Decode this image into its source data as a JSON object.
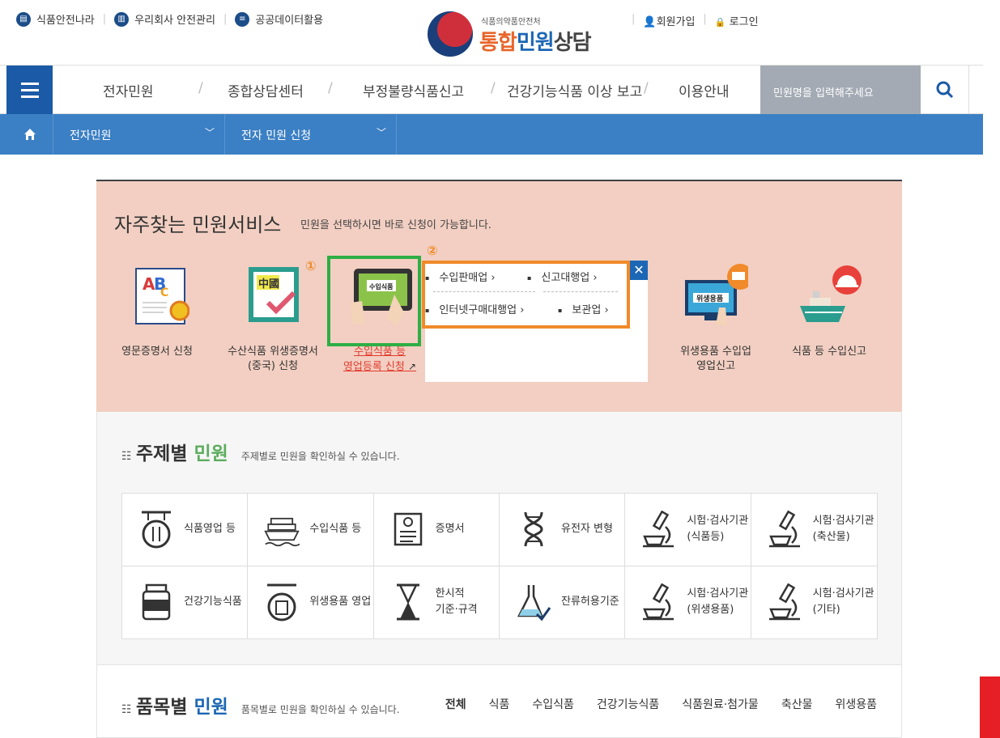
{
  "util_links": [
    "식품안전나라",
    "우리회사 안전관리",
    "공공데이터활용"
  ],
  "logo": {
    "sub": "식품의약품안전처",
    "main_a": "통합",
    "main_b": "민원",
    "main_c": "상담"
  },
  "account": {
    "join": "회원가입",
    "login": "로그인"
  },
  "gnb": {
    "items": [
      "전자민원",
      "종합상담센터",
      "부정불량식품신고",
      "건강기능식품 이상 보고",
      "이용안내"
    ],
    "search_placeholder": "민원명을 입력해주세요"
  },
  "location": {
    "depth1": "전자민원",
    "depth2": "전자 민원 신청"
  },
  "frequent": {
    "title": "자주찾는 민원서비스",
    "desc": "민원을 선택하시면 바로 신청이 가능합니다.",
    "services": [
      {
        "line1": "영문증명서 신청",
        "line2": ""
      },
      {
        "line1": "수산식품 위생증명서",
        "line2": "(중국) 신청"
      },
      {
        "line1": "수입식품 등",
        "line2": "영업등록 신청"
      },
      {
        "line1": "위생용품 수입업",
        "line2": "영업신고"
      },
      {
        "line1": "식품 등 수입신고",
        "line2": ""
      }
    ],
    "marker1": "①",
    "marker2": "②",
    "img_labels": {
      "china": "中國",
      "import": "수입식품",
      "hygiene": "위생용품"
    },
    "popup": {
      "options": [
        "수입판매업",
        "신고대행업",
        "인터넷구매대행업",
        "보관업"
      ]
    }
  },
  "topic": {
    "title": "주제별",
    "title_accent": "민원",
    "desc": "주제별로 민원을 확인하실 수 있습니다.",
    "cells": [
      {
        "l1": "식품영업 등",
        "l2": ""
      },
      {
        "l1": "수입식품 등",
        "l2": ""
      },
      {
        "l1": "증명서",
        "l2": ""
      },
      {
        "l1": "유전자 변형",
        "l2": ""
      },
      {
        "l1": "시험·검사기관",
        "l2": "(식품등)"
      },
      {
        "l1": "시험·검사기관",
        "l2": "(축산물)"
      },
      {
        "l1": "건강기능식품",
        "l2": ""
      },
      {
        "l1": "위생용품 영업",
        "l2": ""
      },
      {
        "l1": "한시적",
        "l2": "기준·규격"
      },
      {
        "l1": "잔류허용기준",
        "l2": ""
      },
      {
        "l1": "시험·검사기관",
        "l2": "(위생용품)"
      },
      {
        "l1": "시험·검사기관",
        "l2": "(기타)"
      }
    ]
  },
  "items": {
    "title": "품목별",
    "title_accent": "민원",
    "desc": "품목별로 민원을 확인하실 수 있습니다.",
    "categories": [
      "전체",
      "식품",
      "수입식품",
      "건강기능식품",
      "식품원료·첨가물",
      "축산물",
      "위생용품"
    ]
  },
  "colors": {
    "brand_blue": "#1b5aa6",
    "loc_blue": "#3b7fc4",
    "green": "#5cad5e",
    "orange": "#f08a2a"
  }
}
